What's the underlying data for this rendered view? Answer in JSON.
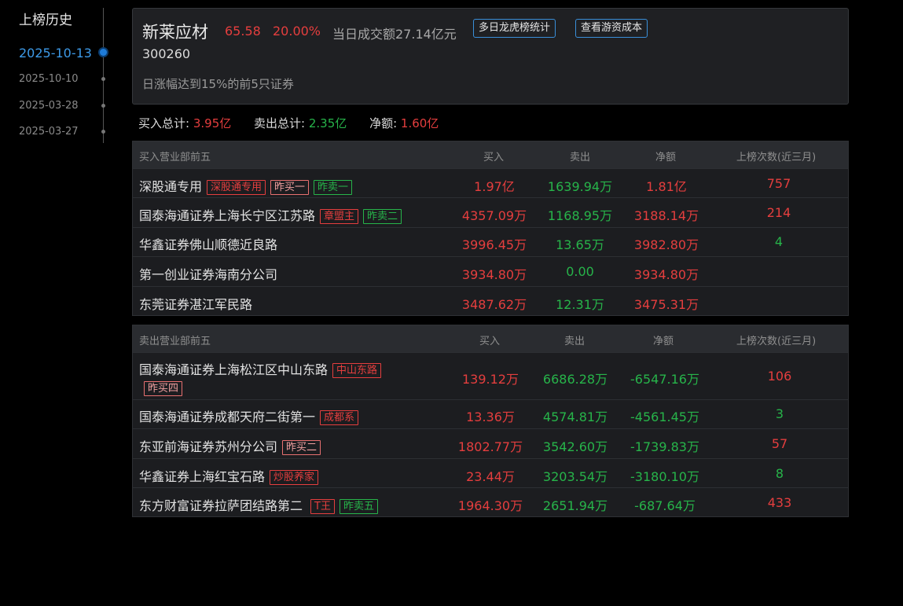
{
  "sidebar": {
    "title": "上榜历史",
    "dates": [
      "2025-10-13",
      "2025-10-10",
      "2025-03-28",
      "2025-03-27"
    ]
  },
  "stock": {
    "name": "新莱应材",
    "price": "65.58",
    "change_pct": "20.00%",
    "turnover": "当日成交额27.14亿元",
    "code": "300260",
    "reason": "日涨幅达到15%的前5只证券",
    "btn_multi_day": "多日龙虎榜统计",
    "btn_cost": "查看游资成本"
  },
  "totals": {
    "buy_label": "买入总计:",
    "buy_value": "3.95亿",
    "sell_label": "卖出总计:",
    "sell_value": "2.35亿",
    "net_label": "净额:",
    "net_value": "1.60亿"
  },
  "buy_table": {
    "headers": [
      "买入营业部前五",
      "买入",
      "卖出",
      "净额",
      "上榜次数(近三月)"
    ],
    "rows": [
      {
        "name": "深股通专用",
        "buy": "1.97亿",
        "sell": "1639.94万",
        "net": "1.81亿",
        "count": "757"
      },
      {
        "name": "国泰海通证券上海长宁区江苏路",
        "buy": "4357.09万",
        "sell": "1168.95万",
        "net": "3188.14万",
        "count": "214"
      },
      {
        "name": "华鑫证券佛山顺德近良路",
        "buy": "3996.45万",
        "sell": "13.65万",
        "net": "3982.80万",
        "count": "4"
      },
      {
        "name": "第一创业证券海南分公司",
        "buy": "3934.80万",
        "sell": "0.00",
        "net": "3934.80万",
        "count": ""
      },
      {
        "name": "东莞证券湛江军民路",
        "buy": "3487.62万",
        "sell": "12.31万",
        "net": "3475.31万",
        "count": ""
      }
    ],
    "tags": {
      "r0": [
        "深股通专用",
        "昨买一",
        "昨卖一"
      ],
      "r1": [
        "章盟主",
        "昨卖二"
      ]
    }
  },
  "sell_table": {
    "headers": [
      "卖出营业部前五",
      "买入",
      "卖出",
      "净额",
      "上榜次数(近三月)"
    ],
    "rows": [
      {
        "name": "国泰海通证券上海松江区中山东路",
        "buy": "139.12万",
        "sell": "6686.28万",
        "net": "-6547.16万",
        "count": "106"
      },
      {
        "name": "国泰海通证券成都天府二街第一",
        "buy": "13.36万",
        "sell": "4574.81万",
        "net": "-4561.45万",
        "count": "3"
      },
      {
        "name": "东亚前海证券苏州分公司",
        "buy": "1802.77万",
        "sell": "3542.60万",
        "net": "-1739.83万",
        "count": "57"
      },
      {
        "name": "华鑫证券上海红宝石路",
        "buy": "23.44万",
        "sell": "3203.54万",
        "net": "-3180.10万",
        "count": "8"
      },
      {
        "name": "东方财富证券拉萨团结路第二",
        "buy": "1964.30万",
        "sell": "2651.94万",
        "net": "-687.64万",
        "count": "433"
      }
    ],
    "tags": {
      "r0": [
        "中山东路",
        "昨买四"
      ],
      "r1": [
        "成都系"
      ],
      "r2": [
        "昨买二"
      ],
      "r3": [
        "炒股养家"
      ],
      "r4": [
        "T王",
        "昨卖五"
      ]
    }
  }
}
